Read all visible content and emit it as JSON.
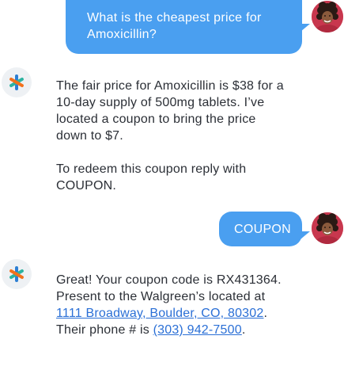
{
  "messages": {
    "user1": {
      "text": "What is the cheapest price for Amoxicillin?"
    },
    "bot1": {
      "paragraph1": "The fair price for Amoxicillin is $38 for a 10-day supply of 500mg tablets. I’ve located a coupon to bring the price down to $7.",
      "paragraph2": "To redeem this coupon reply with COUPON."
    },
    "user2": {
      "text": "COUPON"
    },
    "bot2": {
      "text_before_address": "Great! Your coupon code is RX431364. Present to the Walgreen’s located at ",
      "address_link": "1111 Broadway, Boulder, CO, 80302",
      "text_after_address": ". Their phone # is ",
      "phone_link": "(303) 942-7500",
      "text_end": "."
    }
  },
  "icons": {
    "bot_avatar": "asterisk-logo-icon",
    "user_avatar": "user-avatar-icon"
  },
  "colors": {
    "user_bubble": "#4a9ff0",
    "link": "#2a6fd6",
    "logo_blue": "#2d7fd3",
    "logo_orange": "#f2711c",
    "logo_teal": "#2bb3a0"
  }
}
